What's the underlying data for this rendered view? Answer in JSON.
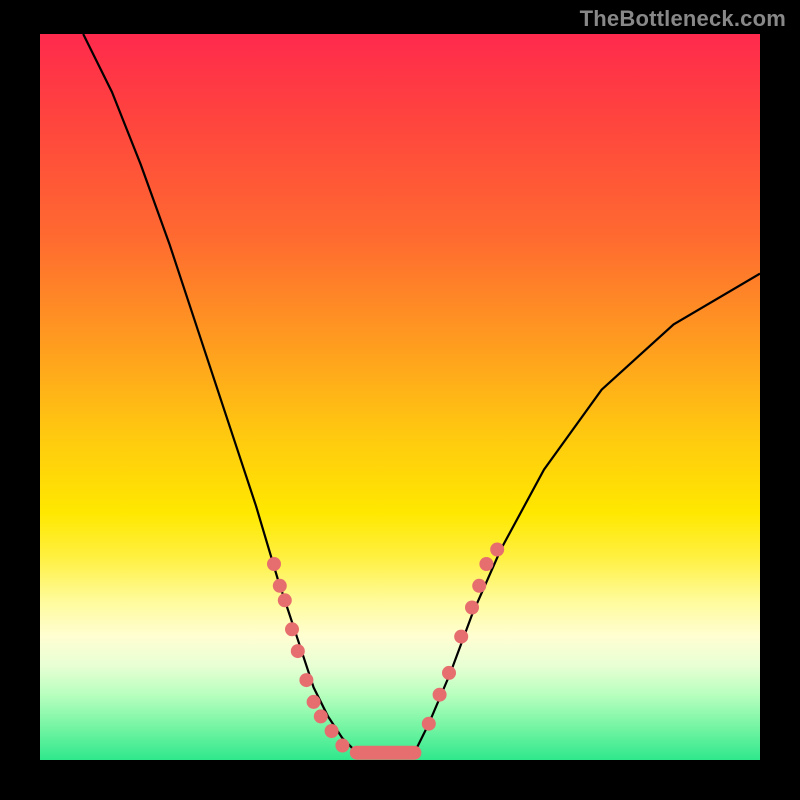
{
  "watermark": "TheBottleneck.com",
  "colors": {
    "dot": "#e76e6e",
    "curve": "#000000",
    "frame": "#000000"
  },
  "chart_data": {
    "type": "line",
    "title": "",
    "xlabel": "",
    "ylabel": "",
    "xlim": [
      0,
      100
    ],
    "ylim": [
      0,
      100
    ],
    "grid": false,
    "legend": false,
    "series": [
      {
        "name": "left-curve",
        "x": [
          6,
          10,
          14,
          18,
          22,
          26,
          30,
          33,
          36,
          38,
          40,
          42,
          44
        ],
        "y": [
          100,
          92,
          82,
          71,
          59,
          47,
          35,
          25,
          16,
          10,
          6,
          3,
          1
        ]
      },
      {
        "name": "right-curve",
        "x": [
          52,
          54,
          57,
          60,
          64,
          70,
          78,
          88,
          100
        ],
        "y": [
          1,
          5,
          12,
          20,
          29,
          40,
          51,
          60,
          67
        ]
      }
    ],
    "flat_segment": {
      "x_start": 44,
      "x_end": 52,
      "y": 1
    },
    "markers_left": [
      {
        "x": 32.5,
        "y": 27
      },
      {
        "x": 33.3,
        "y": 24
      },
      {
        "x": 34.0,
        "y": 22
      },
      {
        "x": 35.0,
        "y": 18
      },
      {
        "x": 35.8,
        "y": 15
      },
      {
        "x": 37.0,
        "y": 11
      },
      {
        "x": 38.0,
        "y": 8
      },
      {
        "x": 39.0,
        "y": 6
      },
      {
        "x": 40.5,
        "y": 4
      },
      {
        "x": 42.0,
        "y": 2
      }
    ],
    "markers_right": [
      {
        "x": 54.0,
        "y": 5
      },
      {
        "x": 55.5,
        "y": 9
      },
      {
        "x": 56.8,
        "y": 12
      },
      {
        "x": 58.5,
        "y": 17
      },
      {
        "x": 60.0,
        "y": 21
      },
      {
        "x": 61.0,
        "y": 24
      },
      {
        "x": 62.0,
        "y": 27
      },
      {
        "x": 63.5,
        "y": 29
      }
    ]
  }
}
